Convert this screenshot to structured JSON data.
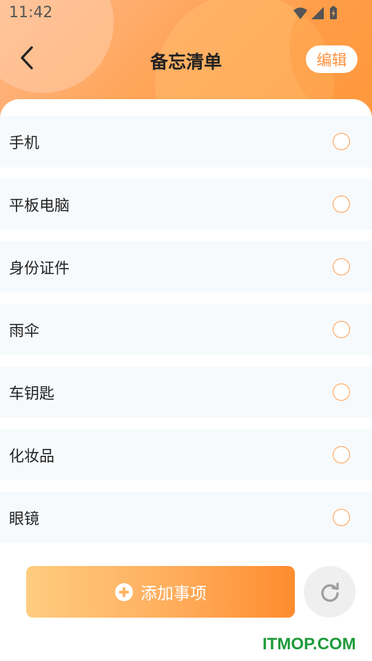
{
  "status_bar": {
    "time": "11:42",
    "icons": [
      "wifi-icon",
      "signal-icon",
      "battery-charging-icon"
    ]
  },
  "header": {
    "back_icon": "chevron-left-icon",
    "title": "备忘清单",
    "edit_label": "编辑"
  },
  "items": [
    {
      "label": "手机",
      "checked": false
    },
    {
      "label": "平板电脑",
      "checked": false
    },
    {
      "label": "身份证件",
      "checked": false
    },
    {
      "label": "雨伞",
      "checked": false
    },
    {
      "label": "车钥匙",
      "checked": false
    },
    {
      "label": "化妆品",
      "checked": false
    },
    {
      "label": "眼镜",
      "checked": false
    }
  ],
  "footer": {
    "add_icon": "plus-circle-icon",
    "add_label": "添加事项",
    "reset_icon": "refresh-icon"
  },
  "watermark": "ITMOP.COM",
  "colors": {
    "accent": "#ff9140",
    "header_start": "#ffb88a",
    "header_end": "#ff9a3c",
    "row_bg": "#f7fafd",
    "checkbox_border": "#ff9a48",
    "watermark": "#1e9a3a"
  }
}
